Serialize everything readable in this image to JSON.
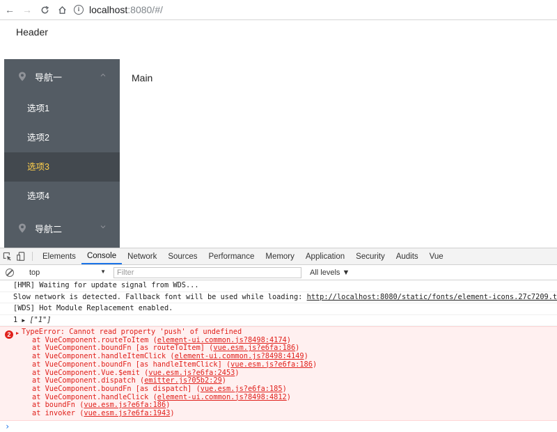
{
  "browser": {
    "url_host": "localhost",
    "url_rest": ":8080/#/"
  },
  "page": {
    "header": "Header",
    "main": "Main",
    "sidebar": {
      "nav1": "导航一",
      "items": [
        "选项1",
        "选项2",
        "选项3",
        "选项4"
      ],
      "active_index": 2,
      "nav2": "导航二",
      "colors": {
        "bg": "#545c64",
        "active_bg": "#43494f",
        "active_text": "#ffd04b",
        "text": "#ffffff"
      }
    }
  },
  "devtools": {
    "tabs": [
      "Elements",
      "Console",
      "Network",
      "Sources",
      "Performance",
      "Memory",
      "Application",
      "Security",
      "Audits",
      "Vue"
    ],
    "active_tab": "Console",
    "context": "top",
    "filter_placeholder": "Filter",
    "levels": "All levels ▼",
    "logs": {
      "hmr": "[HMR] Waiting for update signal from WDS...",
      "slow_prefix": "Slow network is detected. Fallback font will be used while loading: ",
      "slow_link": "http://localhost:8080/static/fonts/element-icons.27c7209.ttf",
      "wds": "[WDS] Hot Module Replacement enabled.",
      "array_count": "1",
      "array_value": "[\"1\"]"
    },
    "error": {
      "count": "2",
      "message": "TypeError: Cannot read property 'push' of undefined",
      "trace": [
        {
          "text": "at VueComponent.routeToItem (",
          "link": "element-ui.common.js?8498:4174",
          "end": ")"
        },
        {
          "text": "at VueComponent.boundFn [as routeToItem] (",
          "link": "vue.esm.js?e6fa:186",
          "end": ")"
        },
        {
          "text": "at VueComponent.handleItemClick (",
          "link": "element-ui.common.js?8498:4149",
          "end": ")"
        },
        {
          "text": "at VueComponent.boundFn [as handleItemClick] (",
          "link": "vue.esm.js?e6fa:186",
          "end": ")"
        },
        {
          "text": "at VueComponent.Vue.$emit (",
          "link": "vue.esm.js?e6fa:2453",
          "end": ")"
        },
        {
          "text": "at VueComponent.dispatch (",
          "link": "emitter.js?05b2:29",
          "end": ")"
        },
        {
          "text": "at VueComponent.boundFn [as dispatch] (",
          "link": "vue.esm.js?e6fa:185",
          "end": ")"
        },
        {
          "text": "at VueComponent.handleClick (",
          "link": "element-ui.common.js?8498:4812",
          "end": ")"
        },
        {
          "text": "at boundFn (",
          "link": "vue.esm.js?e6fa:186",
          "end": ")"
        },
        {
          "text": "at invoker (",
          "link": "vue.esm.js?e6fa:1943",
          "end": ")"
        }
      ]
    },
    "prompt": "›"
  }
}
